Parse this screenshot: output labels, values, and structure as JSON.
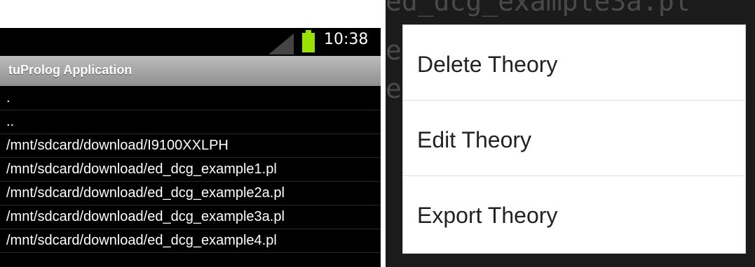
{
  "status_bar": {
    "time": "10:38"
  },
  "app": {
    "title": "tuProlog Application"
  },
  "files": [
    ".",
    "..",
    "/mnt/sdcard/download/I9100XXLPH",
    "/mnt/sdcard/download/ed_dcg_example1.pl",
    "/mnt/sdcard/download/ed_dcg_example2a.pl",
    "/mnt/sdcard/download/ed_dcg_example3a.pl",
    "/mnt/sdcard/download/ed_dcg_example4.pl"
  ],
  "background_text": {
    "line1": "ed_dcg_example3a.pl",
    "line2": "e",
    "line3": "e"
  },
  "context_menu": {
    "items": [
      "Delete Theory",
      "Edit Theory",
      "Export Theory"
    ]
  },
  "colors": {
    "battery": "#9ae000",
    "titlebar": "#a6a6a6"
  }
}
